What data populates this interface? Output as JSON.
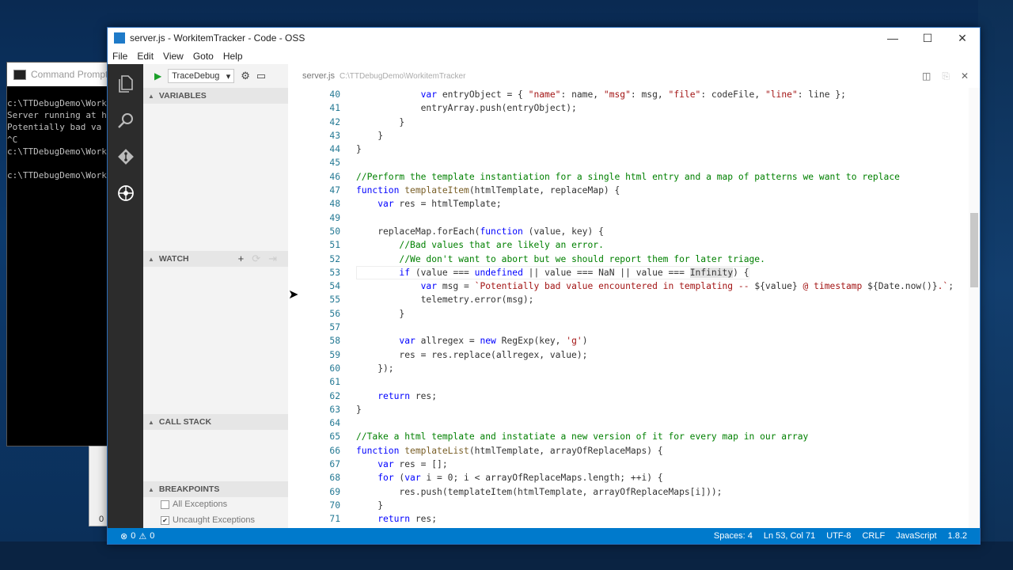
{
  "cmd": {
    "title": "Command Prompt",
    "lines": [
      "c:\\TTDebugDemo\\Work",
      "Server running at h",
      "Potentially bad va",
      "^C",
      "c:\\TTDebugDemo\\Work",
      "",
      "c:\\TTDebugDemo\\Work"
    ],
    "second_window_text": "0"
  },
  "window": {
    "title": "server.js - WorkitemTracker - Code - OSS",
    "controls": {
      "minimize": "—",
      "maximize": "☐",
      "close": "✕"
    }
  },
  "menu": [
    "File",
    "Edit",
    "View",
    "Goto",
    "Help"
  ],
  "debug": {
    "config": "TraceDebug",
    "sections": {
      "variables": "VARIABLES",
      "watch": "WATCH",
      "call_stack": "CALL STACK",
      "breakpoints": "BREAKPOINTS"
    },
    "breakpoints": [
      {
        "label": "All Exceptions",
        "checked": false
      },
      {
        "label": "Uncaught Exceptions",
        "checked": true
      }
    ]
  },
  "editor": {
    "file": "server.js",
    "path": "C:\\TTDebugDemo\\WorkitemTracker",
    "lines": [
      {
        "n": "40",
        "html": "            <span class='k'>var</span> entryObject = { <span class='s'>\"name\"</span>: name, <span class='s'>\"msg\"</span>: msg, <span class='s'>\"file\"</span>: codeFile, <span class='s'>\"line\"</span>: line };"
      },
      {
        "n": "41",
        "html": "            entryArray.push(entryObject);"
      },
      {
        "n": "42",
        "html": "        }"
      },
      {
        "n": "43",
        "html": "    }"
      },
      {
        "n": "44",
        "html": "}"
      },
      {
        "n": "45",
        "html": ""
      },
      {
        "n": "46",
        "html": "<span class='c'>//Perform the template instantiation for a single html entry and a map of patterns we want to replace</span>"
      },
      {
        "n": "47",
        "html": "<span class='k'>function</span> <span class='f'>templateItem</span>(htmlTemplate, replaceMap) {"
      },
      {
        "n": "48",
        "html": "    <span class='k'>var</span> res = htmlTemplate;"
      },
      {
        "n": "49",
        "html": ""
      },
      {
        "n": "50",
        "html": "    replaceMap.forEach(<span class='k'>function</span> (value, key) {"
      },
      {
        "n": "51",
        "html": "        <span class='c'>//Bad values that are likely an error.</span>"
      },
      {
        "n": "52",
        "html": "        <span class='c'>//We don't want to abort but we should report them for later triage.</span>"
      },
      {
        "n": "53",
        "html": "        <span class='k'>if</span> (value === <span class='k'>undefined</span> || value === NaN || value === <span class='hl'>Infinity</span>) {"
      },
      {
        "n": "54",
        "html": "            <span class='k'>var</span> msg = <span class='s'>`Potentially bad value encountered in templating -- </span>${value}<span class='s'> @ timestamp </span>${Date.now()}<span class='s'>.`</span>;"
      },
      {
        "n": "55",
        "html": "            telemetry.error(msg);"
      },
      {
        "n": "56",
        "html": "        }"
      },
      {
        "n": "57",
        "html": ""
      },
      {
        "n": "58",
        "html": "        <span class='k'>var</span> allregex = <span class='k'>new</span> RegExp(key, <span class='s'>'g'</span>)"
      },
      {
        "n": "59",
        "html": "        res = res.replace(allregex, value);"
      },
      {
        "n": "60",
        "html": "    });"
      },
      {
        "n": "61",
        "html": ""
      },
      {
        "n": "62",
        "html": "    <span class='k'>return</span> res;"
      },
      {
        "n": "63",
        "html": "}"
      },
      {
        "n": "64",
        "html": ""
      },
      {
        "n": "65",
        "html": "<span class='c'>//Take a html template and instatiate a new version of it for every map in our array</span>"
      },
      {
        "n": "66",
        "html": "<span class='k'>function</span> <span class='f'>templateList</span>(htmlTemplate, arrayOfReplaceMaps) {"
      },
      {
        "n": "67",
        "html": "    <span class='k'>var</span> res = [];"
      },
      {
        "n": "68",
        "html": "    <span class='k'>for</span> (<span class='k'>var</span> i = 0; i &lt; arrayOfReplaceMaps.length; ++i) {"
      },
      {
        "n": "69",
        "html": "        res.push(templateItem(htmlTemplate, arrayOfReplaceMaps[i]));"
      },
      {
        "n": "70",
        "html": "    }"
      },
      {
        "n": "71",
        "html": "    <span class='k'>return</span> res;"
      }
    ]
  },
  "status": {
    "errors": "0",
    "warnings": "0",
    "spaces": "Spaces: 4",
    "position": "Ln 53, Col 71",
    "encoding": "UTF-8",
    "eol": "CRLF",
    "language": "JavaScript",
    "version": "1.8.2"
  }
}
